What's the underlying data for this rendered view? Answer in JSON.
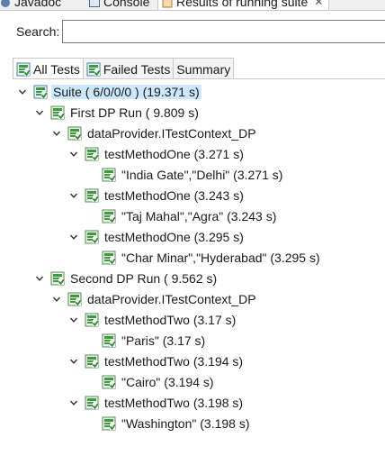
{
  "view_tabs": [
    {
      "label": "Javadoc"
    },
    {
      "label": "Console"
    },
    {
      "label": "Results of running suite"
    }
  ],
  "search": {
    "label": "Search:",
    "value": "",
    "placeholder": ""
  },
  "result_tabs": [
    {
      "label": "All Tests"
    },
    {
      "label": "Failed Tests"
    },
    {
      "label": "Summary"
    }
  ],
  "tree": {
    "suite": "Suite ( 6/0/0/0 ) (19.371 s)",
    "run1": "First DP Run ( 9.809 s)",
    "run1_class": "dataProvider.ITestContext_DP",
    "run1_m1": "testMethodOne  (3.271 s)",
    "run1_m1_p": "\"India Gate\",\"Delhi\"  (3.271 s)",
    "run1_m2": "testMethodOne  (3.243 s)",
    "run1_m2_p": "\"Taj Mahal\",\"Agra\"  (3.243 s)",
    "run1_m3": "testMethodOne  (3.295 s)",
    "run1_m3_p": "\"Char Minar\",\"Hyderabad\"  (3.295 s)",
    "run2": "Second DP Run ( 9.562 s)",
    "run2_class": "dataProvider.ITestContext_DP",
    "run2_m1": "testMethodTwo  (3.17 s)",
    "run2_m1_p": "\"Paris\"  (3.17 s)",
    "run2_m2": "testMethodTwo  (3.194 s)",
    "run2_m2_p": "\"Cairo\"  (3.194 s)",
    "run2_m3": "testMethodTwo  (3.198 s)",
    "run2_m3_p": "\"Washington\"  (3.198 s)"
  },
  "colors": {
    "pass_green": "#3c9b3c",
    "selection": "#cce8ff",
    "border": "#c8c8c8"
  },
  "icons": {
    "suite": "suite-icon",
    "test": "test-pass-icon",
    "expand": "chevron-down-icon",
    "tab_all": "all-tests-icon",
    "tab_failed": "failed-tests-icon"
  }
}
